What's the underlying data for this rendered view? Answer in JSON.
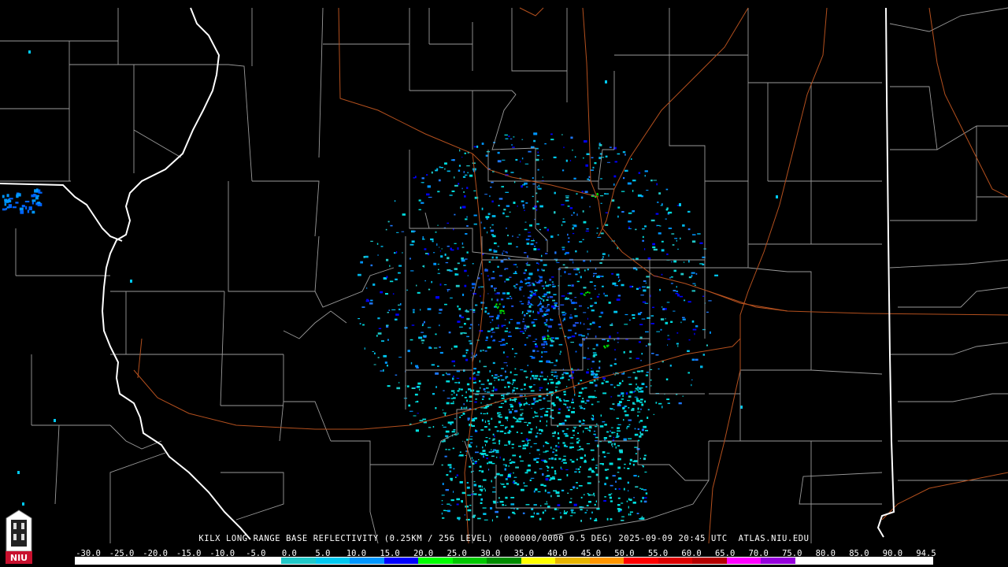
{
  "product_title": "KILX LONG RANGE BASE REFLECTIVITY (0.25KM / 256 LEVEL) (000000/0000 0.5 DEG) 2025-09-09 20:45 UTC  ATLAS.NIU.EDU",
  "logo_text": "NIU",
  "legend": {
    "ticks": [
      "-30.0",
      "-25.0",
      "-20.0",
      "-15.0",
      "-10.0",
      "-5.0",
      "0.0",
      "5.0",
      "10.0",
      "15.0",
      "20.0",
      "25.0",
      "30.0",
      "35.0",
      "40.0",
      "45.0",
      "50.0",
      "55.0",
      "60.0",
      "65.0",
      "70.0",
      "75.0",
      "80.0",
      "85.0",
      "90.0",
      "94.5"
    ],
    "colors": [
      "#ffffff",
      "#ffffff",
      "#ffffff",
      "#ffffff",
      "#ffffff",
      "#ffffff",
      "#20c8c8",
      "#00c8f0",
      "#0096ff",
      "#0000ff",
      "#00ff00",
      "#00c800",
      "#008c00",
      "#ffff00",
      "#e6b400",
      "#ff9600",
      "#ff0000",
      "#dc0000",
      "#b40000",
      "#ff00ff",
      "#9600dc",
      "#ffffff",
      "#ffffff",
      "#ffffff",
      "#ffffff"
    ]
  },
  "map_colors": {
    "background": "#000000",
    "state_border": "#ffffff",
    "county_border": "#b4b4b4",
    "roads": "#b4501e",
    "radar_site": "#000000"
  }
}
